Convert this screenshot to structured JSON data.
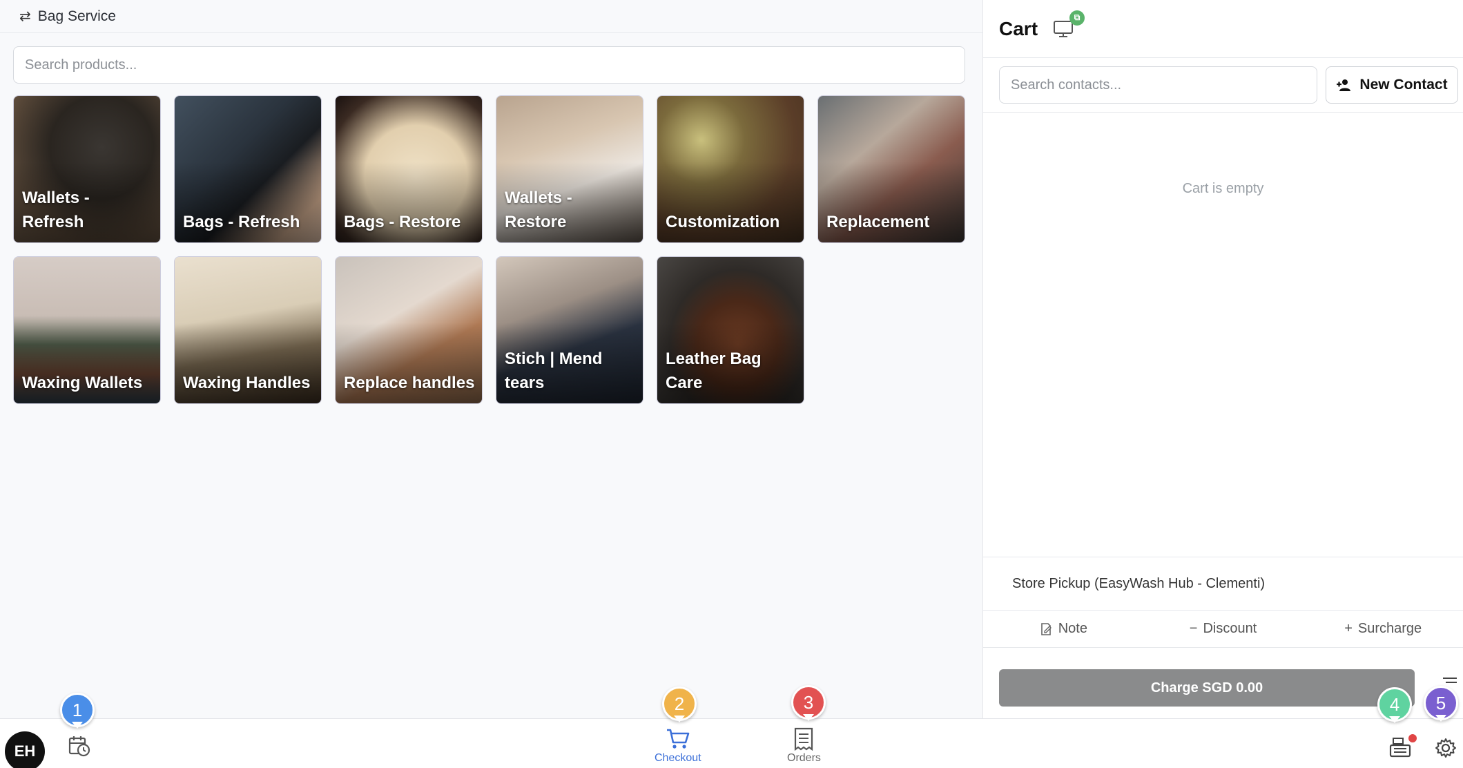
{
  "header": {
    "back_icon": "swap-arrows-icon",
    "title": "Bag Service"
  },
  "search": {
    "placeholder": "Search products..."
  },
  "products": [
    {
      "label": "Wallets - Refresh"
    },
    {
      "label": "Bags - Refresh"
    },
    {
      "label": "Bags - Restore"
    },
    {
      "label": "Wallets - Restore"
    },
    {
      "label": "Customization"
    },
    {
      "label": "Replacement"
    },
    {
      "label": "Waxing Wallets"
    },
    {
      "label": "Waxing Handles"
    },
    {
      "label": "Replace handles"
    },
    {
      "label": "Stich | Mend tears"
    },
    {
      "label": "Leather Bag Care"
    }
  ],
  "cart": {
    "title": "Cart",
    "display_badge": "⧉",
    "contact_placeholder": "Search contacts...",
    "new_contact_label": "New Contact",
    "empty_text": "Cart is empty",
    "pickup": "Store Pickup (EasyWash Hub - Clementi)",
    "note_label": "Note",
    "discount_label": "Discount",
    "surcharge_label": "Surcharge",
    "charge_label": "Charge SGD 0.00"
  },
  "bottom_nav": {
    "avatar_initials": "EH",
    "checkout_label": "Checkout",
    "orders_label": "Orders"
  },
  "markers": [
    "1",
    "2",
    "3",
    "4",
    "5"
  ],
  "colors": {
    "accent": "#3b6fd8",
    "charge_bg": "#8a8b8c"
  }
}
